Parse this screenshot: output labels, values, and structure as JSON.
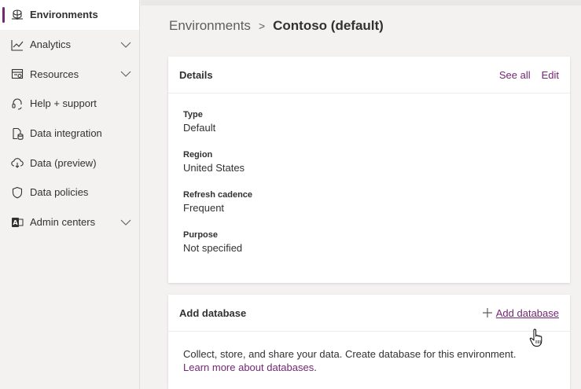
{
  "sidebar": {
    "items": [
      {
        "label": "Environments",
        "icon": "environments-icon",
        "active": true
      },
      {
        "label": "Analytics",
        "icon": "analytics-icon",
        "expandable": true
      },
      {
        "label": "Resources",
        "icon": "resources-icon",
        "expandable": true
      },
      {
        "label": "Help + support",
        "icon": "headset-icon"
      },
      {
        "label": "Data integration",
        "icon": "data-integration-icon"
      },
      {
        "label": "Data (preview)",
        "icon": "cloud-data-icon"
      },
      {
        "label": "Data policies",
        "icon": "shield-icon"
      },
      {
        "label": "Admin centers",
        "icon": "admin-centers-icon",
        "expandable": true
      }
    ]
  },
  "breadcrumb": {
    "parent": "Environments",
    "separator": ">",
    "current": "Contoso (default)"
  },
  "details": {
    "title": "Details",
    "see_all": "See all",
    "edit": "Edit",
    "fields": [
      {
        "label": "Type",
        "value": "Default"
      },
      {
        "label": "Region",
        "value": "United States"
      },
      {
        "label": "Refresh cadence",
        "value": "Frequent"
      },
      {
        "label": "Purpose",
        "value": "Not specified"
      }
    ]
  },
  "add_database": {
    "title": "Add database",
    "action_label": "Add database",
    "description": "Collect, store, and share your data. Create database for this environment.",
    "learn_more": "Learn more about databases",
    "learn_more_suffix": "."
  },
  "colors": {
    "accent": "#742774",
    "sidebar_bg": "#f3f2f1",
    "card_bg": "#ffffff",
    "text": "#323130",
    "muted": "#605e5c"
  }
}
